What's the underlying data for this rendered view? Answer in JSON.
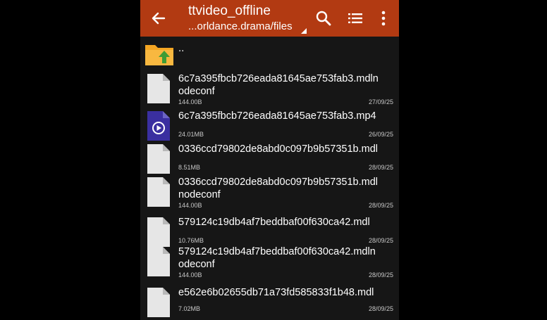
{
  "header": {
    "title": "ttvideo_offline",
    "path": "...orldance.drama/files"
  },
  "icons": {
    "back": "arrow-back-icon",
    "search": "search-icon",
    "view": "list-view-icon",
    "more": "more-vert-icon",
    "parent": "folder-up-icon",
    "file": "file-icon",
    "video": "video-file-icon"
  },
  "colors": {
    "appbar": "#b23a12",
    "background": "#161616",
    "folder": "#f5a623",
    "video_icon": "#3a2fa0"
  },
  "parent": {
    "label": ".."
  },
  "files": [
    {
      "line1": "6c7a395fbcb726eada81645ae753fab3.mdln",
      "line2": "odeconf",
      "size": "144.00B",
      "date": "27/09/25",
      "type": "file"
    },
    {
      "line1": "6c7a395fbcb726eada81645ae753fab3.mp4",
      "line2": "",
      "size": "24.01MB",
      "date": "26/09/25",
      "type": "video"
    },
    {
      "line1": "0336ccd79802de8abd0c097b9b57351b.mdl",
      "line2": "",
      "size": "8.51MB",
      "date": "28/09/25",
      "type": "file"
    },
    {
      "line1": "0336ccd79802de8abd0c097b9b57351b.mdl",
      "line2": "nodeconf",
      "size": "144.00B",
      "date": "28/09/25",
      "type": "file"
    },
    {
      "line1": "579124c19db4af7beddbaf00f630ca42.mdl",
      "line2": "",
      "size": "10.76MB",
      "date": "28/09/25",
      "type": "file"
    },
    {
      "line1": "579124c19db4af7beddbaf00f630ca42.mdln",
      "line2": "odeconf",
      "size": "144.00B",
      "date": "28/09/25",
      "type": "file"
    },
    {
      "line1": "e562e6b02655db71a73fd585833f1b48.mdl",
      "line2": "",
      "size": "7.02MB",
      "date": "28/09/25",
      "type": "file"
    }
  ]
}
